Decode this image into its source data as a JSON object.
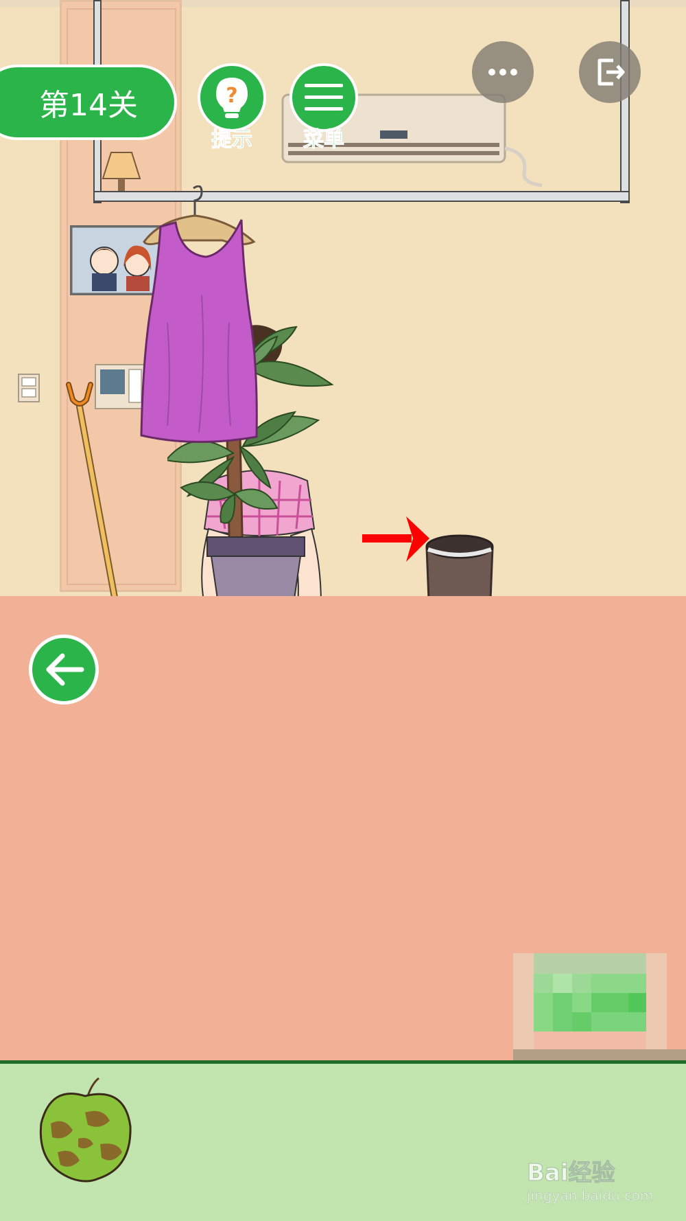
{
  "header": {
    "level_label": "第14关",
    "hint_label": "提示",
    "menu_label": "菜单"
  },
  "icons": {
    "more": "more-dots-icon",
    "exit": "exit-icon",
    "hint": "lightbulb-question-icon",
    "menu": "hamburger-menu-icon",
    "back": "arrow-left-icon"
  },
  "inventory": {
    "items": [
      {
        "name": "rotten-apple"
      }
    ]
  },
  "watermark": {
    "brand": "Bai经验",
    "url": "jingyan.baidu.com"
  },
  "colors": {
    "button_green": "#2bb44a",
    "wall": "#f3e0bd",
    "floor": "#f2b196",
    "inventory_bar": "#c2e4ae",
    "arrow_red": "#ff0000"
  }
}
